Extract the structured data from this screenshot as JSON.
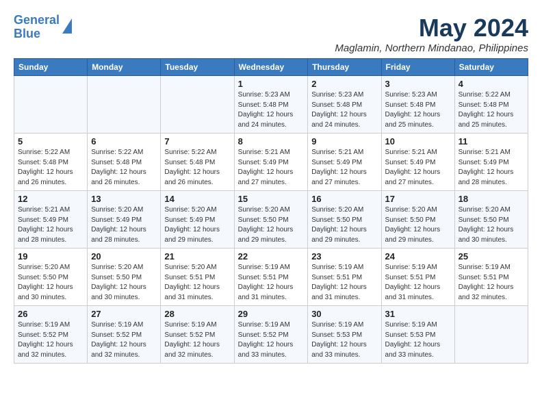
{
  "logo": {
    "line1": "General",
    "line2": "Blue"
  },
  "title": "May 2024",
  "location": "Maglamin, Northern Mindanao, Philippines",
  "headers": [
    "Sunday",
    "Monday",
    "Tuesday",
    "Wednesday",
    "Thursday",
    "Friday",
    "Saturday"
  ],
  "weeks": [
    [
      {
        "day": "",
        "detail": ""
      },
      {
        "day": "",
        "detail": ""
      },
      {
        "day": "",
        "detail": ""
      },
      {
        "day": "1",
        "detail": "Sunrise: 5:23 AM\nSunset: 5:48 PM\nDaylight: 12 hours\nand 24 minutes."
      },
      {
        "day": "2",
        "detail": "Sunrise: 5:23 AM\nSunset: 5:48 PM\nDaylight: 12 hours\nand 24 minutes."
      },
      {
        "day": "3",
        "detail": "Sunrise: 5:23 AM\nSunset: 5:48 PM\nDaylight: 12 hours\nand 25 minutes."
      },
      {
        "day": "4",
        "detail": "Sunrise: 5:22 AM\nSunset: 5:48 PM\nDaylight: 12 hours\nand 25 minutes."
      }
    ],
    [
      {
        "day": "5",
        "detail": "Sunrise: 5:22 AM\nSunset: 5:48 PM\nDaylight: 12 hours\nand 26 minutes."
      },
      {
        "day": "6",
        "detail": "Sunrise: 5:22 AM\nSunset: 5:48 PM\nDaylight: 12 hours\nand 26 minutes."
      },
      {
        "day": "7",
        "detail": "Sunrise: 5:22 AM\nSunset: 5:48 PM\nDaylight: 12 hours\nand 26 minutes."
      },
      {
        "day": "8",
        "detail": "Sunrise: 5:21 AM\nSunset: 5:49 PM\nDaylight: 12 hours\nand 27 minutes."
      },
      {
        "day": "9",
        "detail": "Sunrise: 5:21 AM\nSunset: 5:49 PM\nDaylight: 12 hours\nand 27 minutes."
      },
      {
        "day": "10",
        "detail": "Sunrise: 5:21 AM\nSunset: 5:49 PM\nDaylight: 12 hours\nand 27 minutes."
      },
      {
        "day": "11",
        "detail": "Sunrise: 5:21 AM\nSunset: 5:49 PM\nDaylight: 12 hours\nand 28 minutes."
      }
    ],
    [
      {
        "day": "12",
        "detail": "Sunrise: 5:21 AM\nSunset: 5:49 PM\nDaylight: 12 hours\nand 28 minutes."
      },
      {
        "day": "13",
        "detail": "Sunrise: 5:20 AM\nSunset: 5:49 PM\nDaylight: 12 hours\nand 28 minutes."
      },
      {
        "day": "14",
        "detail": "Sunrise: 5:20 AM\nSunset: 5:49 PM\nDaylight: 12 hours\nand 29 minutes."
      },
      {
        "day": "15",
        "detail": "Sunrise: 5:20 AM\nSunset: 5:50 PM\nDaylight: 12 hours\nand 29 minutes."
      },
      {
        "day": "16",
        "detail": "Sunrise: 5:20 AM\nSunset: 5:50 PM\nDaylight: 12 hours\nand 29 minutes."
      },
      {
        "day": "17",
        "detail": "Sunrise: 5:20 AM\nSunset: 5:50 PM\nDaylight: 12 hours\nand 29 minutes."
      },
      {
        "day": "18",
        "detail": "Sunrise: 5:20 AM\nSunset: 5:50 PM\nDaylight: 12 hours\nand 30 minutes."
      }
    ],
    [
      {
        "day": "19",
        "detail": "Sunrise: 5:20 AM\nSunset: 5:50 PM\nDaylight: 12 hours\nand 30 minutes."
      },
      {
        "day": "20",
        "detail": "Sunrise: 5:20 AM\nSunset: 5:50 PM\nDaylight: 12 hours\nand 30 minutes."
      },
      {
        "day": "21",
        "detail": "Sunrise: 5:20 AM\nSunset: 5:51 PM\nDaylight: 12 hours\nand 31 minutes."
      },
      {
        "day": "22",
        "detail": "Sunrise: 5:19 AM\nSunset: 5:51 PM\nDaylight: 12 hours\nand 31 minutes."
      },
      {
        "day": "23",
        "detail": "Sunrise: 5:19 AM\nSunset: 5:51 PM\nDaylight: 12 hours\nand 31 minutes."
      },
      {
        "day": "24",
        "detail": "Sunrise: 5:19 AM\nSunset: 5:51 PM\nDaylight: 12 hours\nand 31 minutes."
      },
      {
        "day": "25",
        "detail": "Sunrise: 5:19 AM\nSunset: 5:51 PM\nDaylight: 12 hours\nand 32 minutes."
      }
    ],
    [
      {
        "day": "26",
        "detail": "Sunrise: 5:19 AM\nSunset: 5:52 PM\nDaylight: 12 hours\nand 32 minutes."
      },
      {
        "day": "27",
        "detail": "Sunrise: 5:19 AM\nSunset: 5:52 PM\nDaylight: 12 hours\nand 32 minutes."
      },
      {
        "day": "28",
        "detail": "Sunrise: 5:19 AM\nSunset: 5:52 PM\nDaylight: 12 hours\nand 32 minutes."
      },
      {
        "day": "29",
        "detail": "Sunrise: 5:19 AM\nSunset: 5:52 PM\nDaylight: 12 hours\nand 33 minutes."
      },
      {
        "day": "30",
        "detail": "Sunrise: 5:19 AM\nSunset: 5:53 PM\nDaylight: 12 hours\nand 33 minutes."
      },
      {
        "day": "31",
        "detail": "Sunrise: 5:19 AM\nSunset: 5:53 PM\nDaylight: 12 hours\nand 33 minutes."
      },
      {
        "day": "",
        "detail": ""
      }
    ]
  ]
}
